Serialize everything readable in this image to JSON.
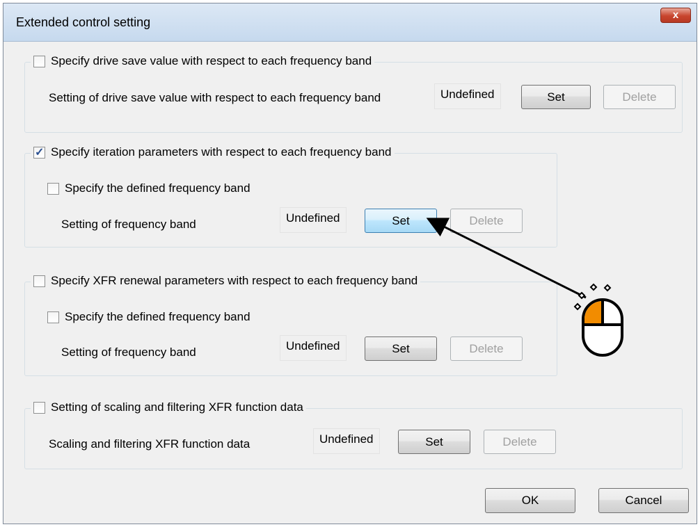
{
  "dialog": {
    "title": "Extended control setting",
    "close_label": "x"
  },
  "groups": [
    {
      "legend": "Specify drive save value with respect to each frequency band",
      "checked": false,
      "row_label": "Setting of drive save value with respect to each frequency band",
      "value": "Undefined",
      "set_label": "Set",
      "delete_label": "Delete"
    },
    {
      "legend": "Specify iteration parameters with respect to each frequency band",
      "checked": true,
      "sub_checkbox_label": "Specify the defined frequency band",
      "row_label": "Setting of frequency band",
      "value": "Undefined",
      "set_label": "Set",
      "delete_label": "Delete"
    },
    {
      "legend": "Specify XFR renewal parameters with respect to each frequency band",
      "checked": false,
      "sub_checkbox_label": "Specify the defined frequency band",
      "row_label": "Setting of frequency band",
      "value": "Undefined",
      "set_label": "Set",
      "delete_label": "Delete"
    },
    {
      "legend": "Setting of scaling and filtering XFR function data",
      "checked": false,
      "row_label": "Scaling and filtering XFR function data",
      "value": "Undefined",
      "set_label": "Set",
      "delete_label": "Delete"
    }
  ],
  "footer": {
    "ok_label": "OK",
    "cancel_label": "Cancel"
  },
  "annotation": {
    "icon": "mouse-click-icon",
    "accent_color": "#f28c00",
    "arrow_target": "Set button (iteration parameters)"
  }
}
